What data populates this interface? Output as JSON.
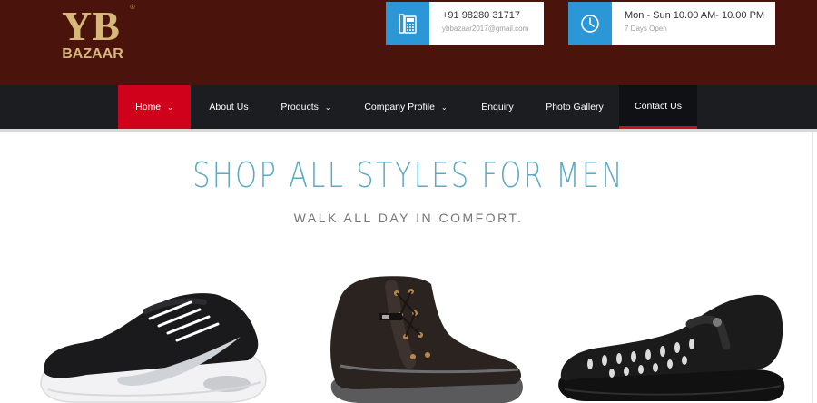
{
  "header": {
    "logo": {
      "letters": "YB",
      "name": "BAZAAR",
      "mark": "®"
    },
    "phone": {
      "number": "+91 98280 31717",
      "email": "ybbazaar2017@gmail.com",
      "icon": "phone-icon"
    },
    "hours": {
      "time": "Mon - Sun 10.00 AM- 10.00 PM",
      "note": "7 Days Open",
      "icon": "clock-icon"
    }
  },
  "nav": {
    "items": [
      {
        "label": "Home",
        "dropdown": true,
        "active": true
      },
      {
        "label": "About Us",
        "dropdown": false
      },
      {
        "label": "Products",
        "dropdown": true
      },
      {
        "label": "Company Profile",
        "dropdown": true
      },
      {
        "label": "Enquiry",
        "dropdown": false
      },
      {
        "label": "Photo Gallery",
        "dropdown": false
      },
      {
        "label": "Contact Us",
        "dropdown": false,
        "highlighted": true
      }
    ],
    "caret": "⌄"
  },
  "banner": {
    "headline": "SHOP ALL STYLES FOR MEN",
    "subline": "WALK ALL DAY IN COMFORT."
  },
  "colors": {
    "header_bg": "#4a140c",
    "nav_bg": "#1b1d21",
    "active_red": "#d0021b",
    "icon_blue": "#2b97d6",
    "headline_blue": "#5fa8c2",
    "logo_gold": "#d6b878"
  }
}
